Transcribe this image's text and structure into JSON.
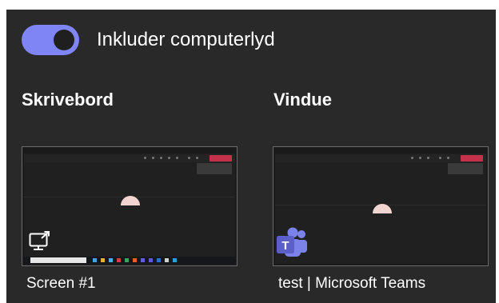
{
  "toggle": {
    "label": "Inkluder computerlyd",
    "on": true,
    "color": "#7f85f5"
  },
  "sections": {
    "screen": {
      "title": "Skrivebord",
      "caption": "Screen #1",
      "icon": "screen-share-icon"
    },
    "window": {
      "title": "Vindue",
      "caption": "test | Microsoft Teams",
      "icon": "microsoft-teams-icon"
    }
  },
  "colors": {
    "background": "#292929",
    "leave_button": "#c4314b",
    "teams_purple": "#5b5fc7"
  }
}
